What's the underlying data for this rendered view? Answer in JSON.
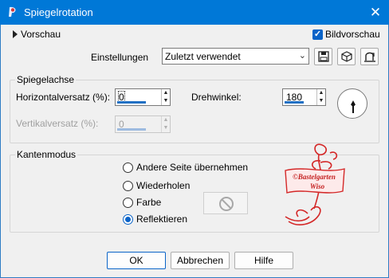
{
  "window": {
    "title": "Spiegelrotation",
    "close_glyph": "✕"
  },
  "preview": {
    "label": "Vorschau",
    "bild_label": "Bildvorschau",
    "bild_checked": true
  },
  "settings": {
    "label": "Einstellungen",
    "value": "Zuletzt verwendet"
  },
  "mirror_axis": {
    "group_label": "Spiegelachse",
    "h_offset_label": "Horizontalversatz (%):",
    "h_offset_value": "0",
    "v_offset_label": "Vertikalversatz (%):",
    "v_offset_value": "0",
    "angle_label": "Drehwinkel:",
    "angle_value": "180"
  },
  "edge_mode": {
    "group_label": "Kantenmodus",
    "options": [
      {
        "label": "Andere Seite übernehmen",
        "checked": false
      },
      {
        "label": "Wiederholen",
        "checked": false
      },
      {
        "label": "Farbe",
        "checked": false
      },
      {
        "label": "Reflektieren",
        "checked": true
      }
    ]
  },
  "watermark": {
    "line1": "©Bastelgarten",
    "line2": "Wiso"
  },
  "buttons": {
    "ok": "OK",
    "cancel": "Abbrechen",
    "help": "Hilfe"
  },
  "colors": {
    "titlebar": "#0078d7",
    "accent": "#0a64c8",
    "watermark": "#d42828"
  }
}
